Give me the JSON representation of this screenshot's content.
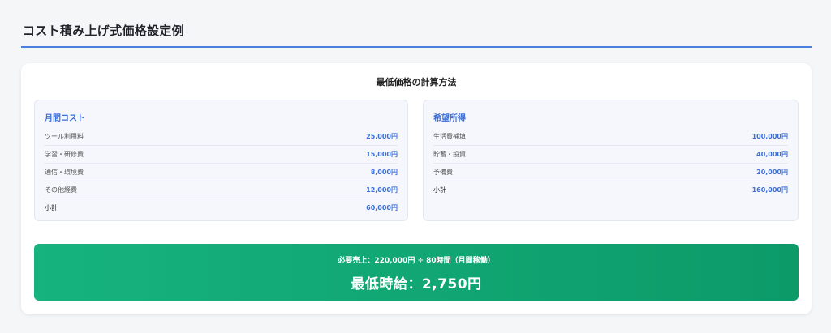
{
  "page": {
    "title": "コスト積み上げ式価格設定例"
  },
  "card": {
    "heading": "最低価格の計算方法"
  },
  "monthly_cost": {
    "title": "月間コスト",
    "rows": [
      {
        "label": "ツール利用料",
        "value": "25,000円"
      },
      {
        "label": "学習・研修費",
        "value": "15,000円"
      },
      {
        "label": "通信・環境費",
        "value": "8,000円"
      },
      {
        "label": "その他経費",
        "value": "12,000円"
      },
      {
        "label": "小計",
        "value": "60,000円"
      }
    ]
  },
  "desired_income": {
    "title": "希望所得",
    "rows": [
      {
        "label": "生活費補填",
        "value": "100,000円"
      },
      {
        "label": "貯蓄・投資",
        "value": "40,000円"
      },
      {
        "label": "予備費",
        "value": "20,000円"
      },
      {
        "label": "小計",
        "value": "160,000円"
      }
    ]
  },
  "result": {
    "formula": "必要売上：220,000円 ÷ 80時間（月間稼働）",
    "main": "最低時給：2,750円"
  },
  "colors": {
    "accent": "#3d6fd6",
    "result_green": "#12a874",
    "rule": "#4a7fe0"
  }
}
